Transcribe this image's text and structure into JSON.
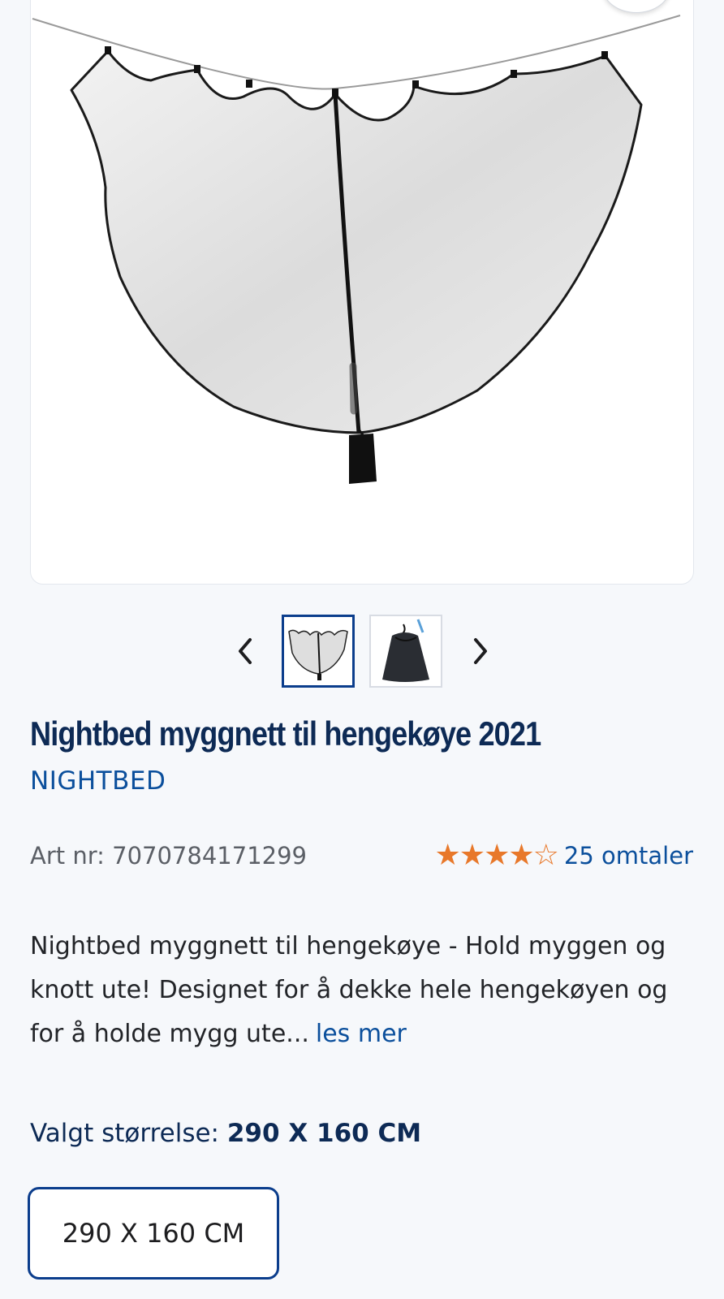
{
  "gallery": {
    "main_image_icon": "mosquito-net-product-image",
    "thumbnails": [
      {
        "icon": "mosquito-net-thumbnail",
        "active": true
      },
      {
        "icon": "storage-bag-thumbnail",
        "active": false
      }
    ],
    "prev_icon": "chevron-left-icon",
    "next_icon": "chevron-right-icon"
  },
  "product": {
    "title": "Nightbed myggnett til hengekøye 2021",
    "brand": "NIGHTBED",
    "art_label": "Art nr: 7070784171299",
    "rating": 4,
    "rating_max": 5,
    "reviews_label": "25 omtaler",
    "description": "Nightbed myggnett til hengekøye - Hold myggen og knott ute! Designet for å dekke hele hengekøyen og for å holde mygg ute...",
    "read_more": "les mer"
  },
  "size": {
    "selected_label": "Valgt størrelse:",
    "selected_value": "290 X 160 CM",
    "options": [
      "290 X 160 CM"
    ]
  },
  "colors": {
    "brand_blue": "#0b4f9c",
    "title_navy": "#0d2a55",
    "star_orange": "#e8782a"
  }
}
